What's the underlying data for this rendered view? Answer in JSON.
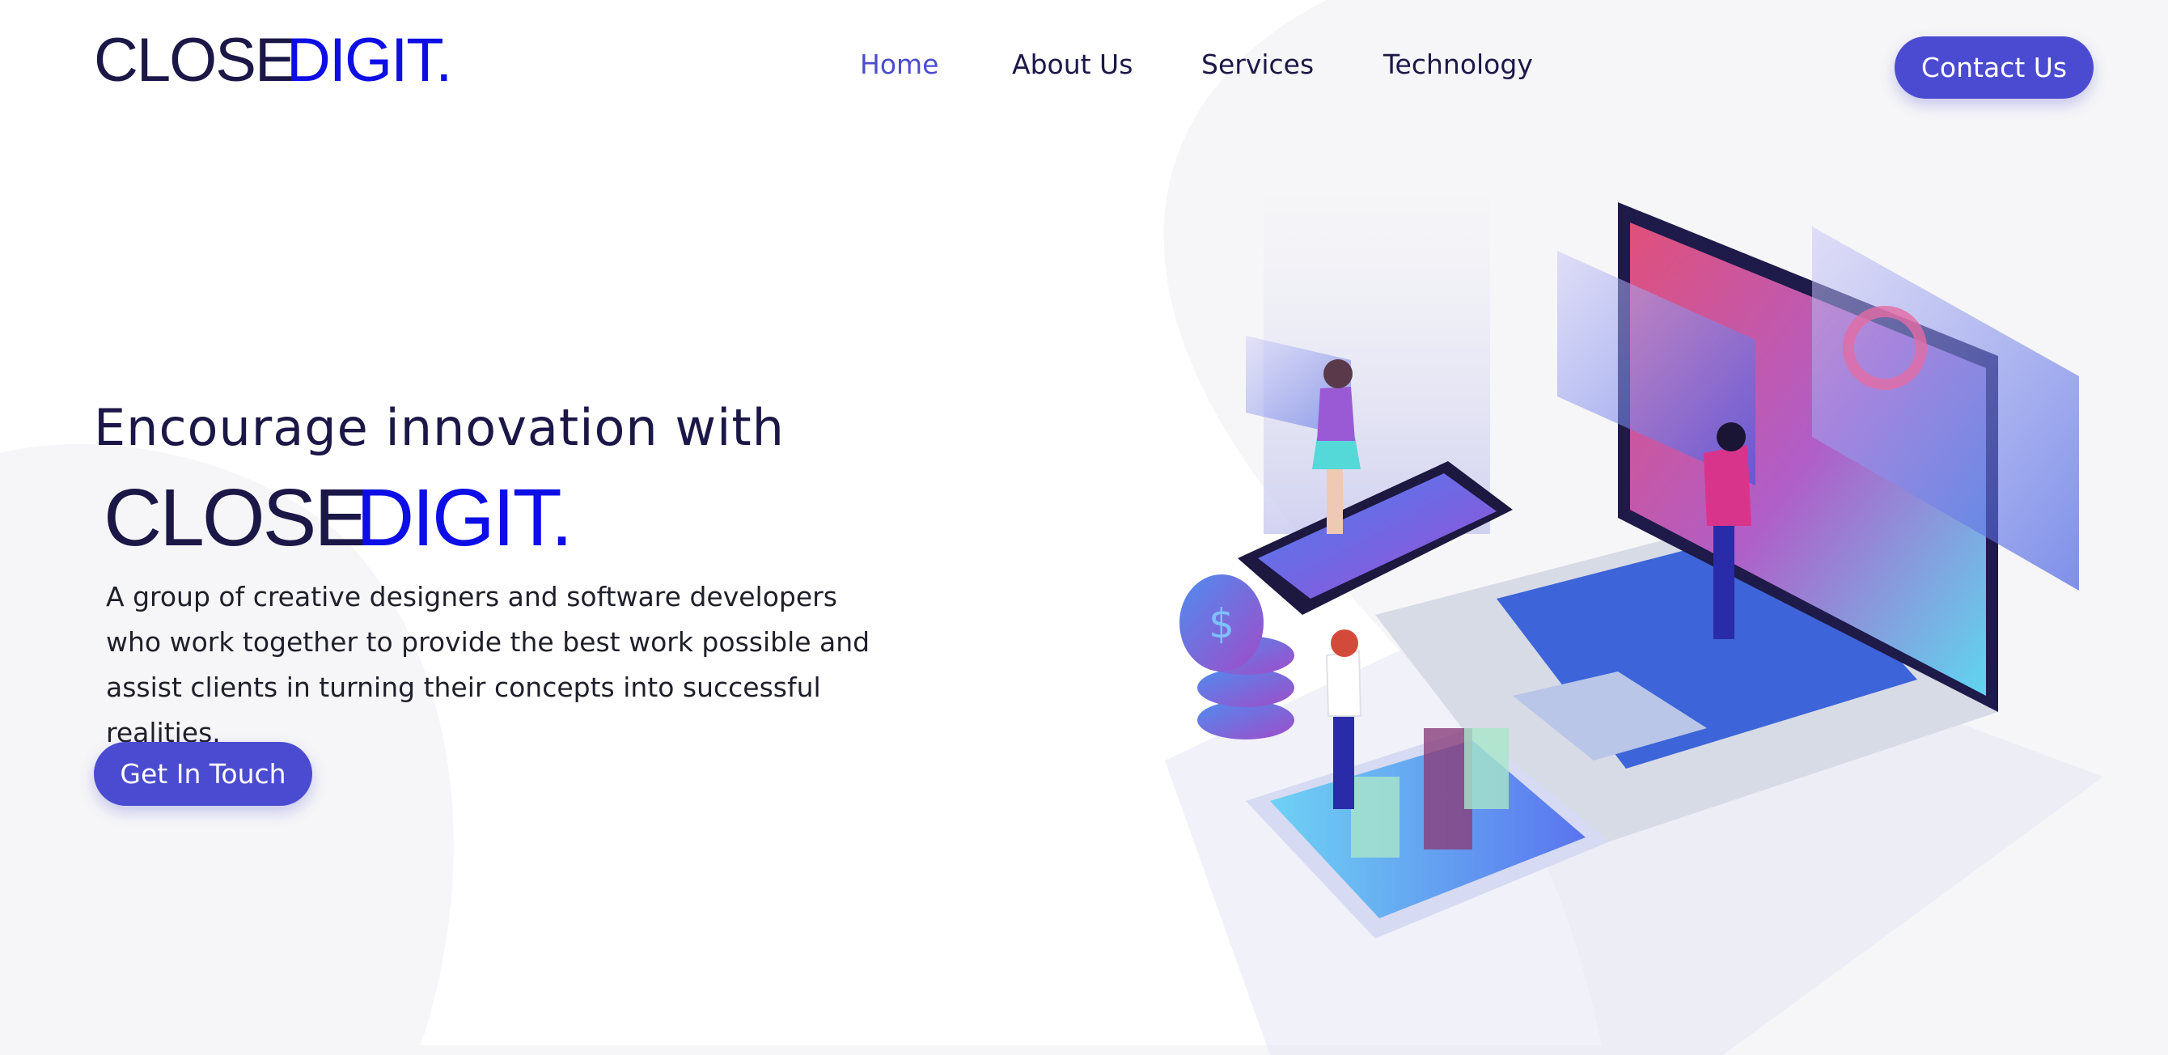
{
  "brand": {
    "logo_dark": "CLOSE",
    "logo_accent": "DIGIT.",
    "dark_color": "#1b1747",
    "accent_color": "#0d0de6"
  },
  "nav": {
    "items": [
      {
        "label": "Home",
        "active": true
      },
      {
        "label": "About Us",
        "active": false
      },
      {
        "label": "Services",
        "active": false
      },
      {
        "label": "Technology",
        "active": false
      }
    ],
    "active_color": "#4b4ccf"
  },
  "header": {
    "contact_label": "Contact Us"
  },
  "hero": {
    "title": "Encourage innovation with",
    "description": "A group of creative designers and software developers who work together to provide the best work possible and assist clients in turning their concepts into successful realities.",
    "cta_label": "Get In Touch"
  },
  "illustration": {
    "icon": "isometric-tech-illustration",
    "coin_symbol": "$"
  },
  "colors": {
    "button": "#4b4bd1",
    "background_shape": "#f6f6f8"
  }
}
